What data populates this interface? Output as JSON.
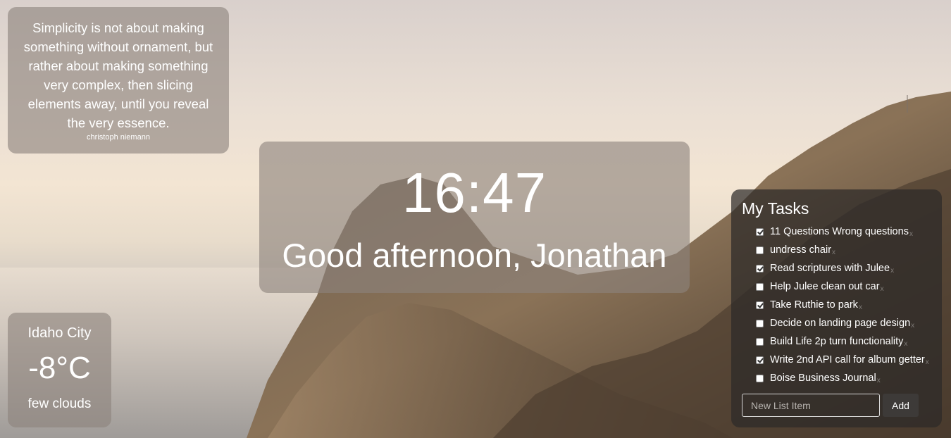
{
  "quote": {
    "text": "Simplicity is not about making something without ornament, but rather about making something very complex, then slicing elements away, until you reveal the very essence.",
    "author": "christoph niemann"
  },
  "clock": {
    "time": "16:47",
    "greeting": "Good afternoon, Jonathan"
  },
  "weather": {
    "city": "Idaho City",
    "temperature": "-8°C",
    "description": "few clouds"
  },
  "tasks": {
    "title": "My Tasks",
    "items": [
      {
        "label": "11 Questions Wrong questions",
        "checked": true
      },
      {
        "label": "undress chair",
        "checked": false
      },
      {
        "label": "Read scriptures with Julee",
        "checked": true
      },
      {
        "label": "Help Julee clean out car",
        "checked": false
      },
      {
        "label": "Take Ruthie to park",
        "checked": true
      },
      {
        "label": "Decide on landing page design",
        "checked": false
      },
      {
        "label": "Build Life 2p turn functionality",
        "checked": false
      },
      {
        "label": "Write 2nd API call for album getter",
        "checked": true
      },
      {
        "label": "Boise Business Journal",
        "checked": false
      }
    ],
    "delete_glyph": "x",
    "input_placeholder": "New List Item",
    "add_label": "Add"
  },
  "icons": {
    "task_delete": "close-icon"
  }
}
